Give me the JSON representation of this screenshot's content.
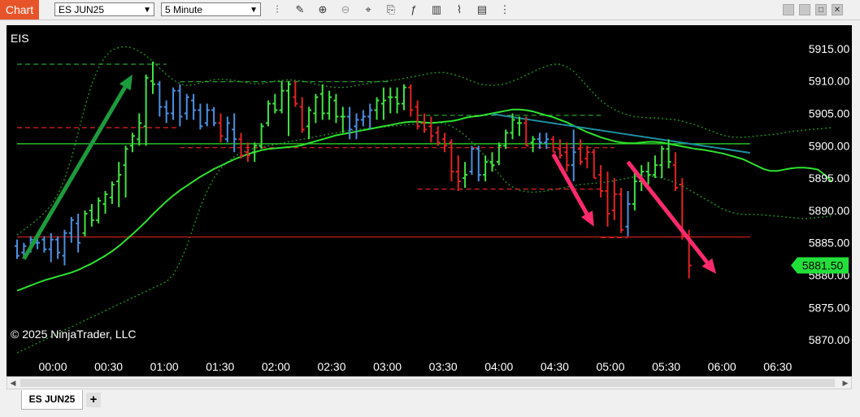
{
  "toolbar": {
    "chart_tab": "Chart",
    "instrument": "ES JUN25",
    "interval": "5 Minute",
    "tool_icons": [
      "bar-style-icon",
      "draw-pencil-icon",
      "zoom-in-icon",
      "zoom-out-icon",
      "crosshair-icon",
      "data-box-icon",
      "indicators-icon",
      "strategies-icon",
      "templates-icon",
      "properties-icon",
      "hide-drawings-icon"
    ]
  },
  "window_buttons": [
    "minimize",
    "restore",
    "maximize",
    "close"
  ],
  "bottom_tabs": {
    "instrument_tab": "ES JUN25",
    "add_tab": "+"
  },
  "chart_data": {
    "type": "ohlc",
    "instrument_label": "EIS",
    "copyright": "© 2025 NinjaTrader, LLC",
    "x_tick_labels": [
      "00:00",
      "00:30",
      "01:00",
      "01:30",
      "02:00",
      "02:30",
      "03:00",
      "03:30",
      "04:00",
      "04:30",
      "05:00",
      "05:30",
      "06:00",
      "06:30"
    ],
    "y_tick_labels": [
      "5915.00",
      "5910.00",
      "5905.00",
      "5900.00",
      "5895.00",
      "5890.00",
      "5885.00",
      "5880.00",
      "5875.00",
      "5870.00"
    ],
    "ylim": [
      5867.5,
      5918.5
    ],
    "last_price": "5881.50",
    "colors": {
      "background": "#000000",
      "up_bar": "#3fe43f",
      "down_bar": "#e52222",
      "neutral_bar": "#4a90e2",
      "bollinger": "#1f8f1f",
      "moving_average": "#2ee22e",
      "annotation_green": "#1c9c3c",
      "annotation_pink": "#ff2a6d",
      "trendline": "#1e8fa0",
      "support_line": "#c81e1e",
      "last_price_bg": "#22e03a"
    },
    "bars": [
      [
        5884.5,
        5885.5,
        5882.5,
        5883.0,
        "n"
      ],
      [
        5883.5,
        5885.0,
        5882.5,
        5884.5,
        "n"
      ],
      [
        5884.0,
        5886.0,
        5883.5,
        5885.5,
        "n"
      ],
      [
        5885.0,
        5886.5,
        5884.0,
        5885.0,
        "n"
      ],
      [
        5885.5,
        5886.0,
        5883.5,
        5884.0,
        "n"
      ],
      [
        5884.0,
        5886.5,
        5882.0,
        5885.5,
        "n"
      ],
      [
        5885.5,
        5886.0,
        5882.5,
        5883.5,
        "n"
      ],
      [
        5883.0,
        5887.0,
        5881.5,
        5886.5,
        "n"
      ],
      [
        5886.5,
        5889.0,
        5885.0,
        5888.5,
        "n"
      ],
      [
        5888.0,
        5889.5,
        5883.5,
        5885.0,
        "n"
      ],
      [
        5886.5,
        5890.0,
        5886.0,
        5889.5,
        "u"
      ],
      [
        5890.0,
        5891.0,
        5887.5,
        5888.5,
        "u"
      ],
      [
        5888.5,
        5892.0,
        5888.0,
        5891.5,
        "u"
      ],
      [
        5891.0,
        5893.0,
        5889.5,
        5892.5,
        "u"
      ],
      [
        5892.0,
        5894.5,
        5891.0,
        5894.0,
        "u"
      ],
      [
        5894.5,
        5897.5,
        5890.5,
        5895.5,
        "u"
      ],
      [
        5897.0,
        5900.0,
        5892.0,
        5899.5,
        "u"
      ],
      [
        5900.0,
        5902.0,
        5899.0,
        5901.5,
        "u"
      ],
      [
        5901.0,
        5905.0,
        5900.0,
        5903.5,
        "u"
      ],
      [
        5903.0,
        5911.0,
        5900.0,
        5910.5,
        "u"
      ],
      [
        5910.0,
        5913.0,
        5908.0,
        5909.5,
        "u"
      ],
      [
        5909.5,
        5910.0,
        5904.5,
        5906.0,
        "n"
      ],
      [
        5906.0,
        5907.0,
        5903.5,
        5905.0,
        "n"
      ],
      [
        5905.0,
        5909.0,
        5904.0,
        5908.5,
        "n"
      ],
      [
        5908.5,
        5909.5,
        5903.0,
        5904.5,
        "n"
      ],
      [
        5905.0,
        5908.0,
        5904.0,
        5907.5,
        "n"
      ],
      [
        5907.0,
        5908.0,
        5904.0,
        5905.5,
        "n"
      ],
      [
        5905.5,
        5906.5,
        5902.5,
        5903.0,
        "n"
      ],
      [
        5903.5,
        5906.5,
        5903.0,
        5905.5,
        "n"
      ],
      [
        5905.5,
        5906.0,
        5903.0,
        5903.5,
        "n"
      ],
      [
        5903.5,
        5905.0,
        5900.5,
        5901.5,
        "d"
      ],
      [
        5901.0,
        5904.5,
        5900.5,
        5903.5,
        "n"
      ],
      [
        5902.5,
        5905.0,
        5899.0,
        5901.0,
        "n"
      ],
      [
        5901.0,
        5902.0,
        5898.0,
        5898.5,
        "d"
      ],
      [
        5899.0,
        5900.5,
        5897.5,
        5898.5,
        "d"
      ],
      [
        5899.0,
        5900.5,
        5897.5,
        5900.0,
        "u"
      ],
      [
        5900.0,
        5903.5,
        5899.5,
        5903.0,
        "u"
      ],
      [
        5903.5,
        5907.0,
        5903.0,
        5906.5,
        "u"
      ],
      [
        5906.5,
        5908.0,
        5905.0,
        5905.5,
        "u"
      ],
      [
        5905.5,
        5910.0,
        5905.0,
        5908.5,
        "u"
      ],
      [
        5908.5,
        5910.0,
        5901.5,
        5909.5,
        "u"
      ],
      [
        5907.5,
        5910.0,
        5906.0,
        5906.5,
        "d"
      ],
      [
        5906.0,
        5907.5,
        5902.0,
        5902.5,
        "d"
      ],
      [
        5903.0,
        5906.0,
        5901.0,
        5905.5,
        "u"
      ],
      [
        5905.0,
        5908.0,
        5903.5,
        5907.5,
        "u"
      ],
      [
        5908.0,
        5909.5,
        5904.0,
        5905.0,
        "u"
      ],
      [
        5905.0,
        5908.5,
        5904.0,
        5907.5,
        "u"
      ],
      [
        5907.0,
        5908.0,
        5903.5,
        5904.5,
        "u"
      ],
      [
        5904.5,
        5906.0,
        5902.0,
        5904.5,
        "u"
      ],
      [
        5904.5,
        5906.0,
        5901.0,
        5902.5,
        "n"
      ],
      [
        5903.0,
        5905.0,
        5901.0,
        5904.0,
        "n"
      ],
      [
        5904.0,
        5905.5,
        5903.0,
        5904.5,
        "n"
      ],
      [
        5904.5,
        5906.5,
        5902.5,
        5905.5,
        "n"
      ],
      [
        5905.5,
        5907.5,
        5904.0,
        5907.0,
        "u"
      ],
      [
        5906.5,
        5909.0,
        5904.0,
        5907.0,
        "u"
      ],
      [
        5907.5,
        5909.0,
        5905.0,
        5907.5,
        "u"
      ],
      [
        5907.5,
        5909.0,
        5905.0,
        5906.5,
        "u"
      ],
      [
        5906.5,
        5909.5,
        5905.5,
        5909.0,
        "u"
      ],
      [
        5909.0,
        5909.5,
        5904.5,
        5905.5,
        "d"
      ],
      [
        5906.0,
        5907.0,
        5902.5,
        5903.0,
        "d"
      ],
      [
        5903.5,
        5905.0,
        5902.0,
        5902.5,
        "d"
      ],
      [
        5903.0,
        5904.5,
        5900.5,
        5901.5,
        "d"
      ],
      [
        5902.0,
        5903.0,
        5900.0,
        5900.5,
        "d"
      ],
      [
        5901.0,
        5902.0,
        5899.0,
        5900.0,
        "d"
      ],
      [
        5900.5,
        5901.0,
        5894.5,
        5896.0,
        "d"
      ],
      [
        5896.0,
        5898.5,
        5893.0,
        5894.5,
        "d"
      ],
      [
        5895.0,
        5897.5,
        5893.5,
        5895.5,
        "u"
      ],
      [
        5896.0,
        5900.0,
        5895.5,
        5899.5,
        "n"
      ],
      [
        5899.5,
        5900.0,
        5894.5,
        5895.5,
        "n"
      ],
      [
        5895.5,
        5898.5,
        5894.5,
        5897.5,
        "u"
      ],
      [
        5897.5,
        5899.0,
        5896.0,
        5897.0,
        "u"
      ],
      [
        5897.5,
        5900.5,
        5897.0,
        5900.0,
        "u"
      ],
      [
        5900.0,
        5902.5,
        5899.5,
        5902.0,
        "u"
      ],
      [
        5902.0,
        5905.0,
        5901.0,
        5904.0,
        "u"
      ],
      [
        5903.5,
        5904.5,
        5901.5,
        5903.5,
        "u"
      ],
      [
        5903.5,
        5904.5,
        5900.0,
        5900.0,
        "d"
      ],
      [
        5900.5,
        5901.5,
        5899.0,
        5901.0,
        "u"
      ],
      [
        5901.0,
        5902.0,
        5899.5,
        5900.5,
        "n"
      ],
      [
        5900.5,
        5902.0,
        5899.5,
        5901.0,
        "n"
      ],
      [
        5901.0,
        5901.5,
        5899.0,
        5899.0,
        "d"
      ],
      [
        5899.5,
        5901.0,
        5898.0,
        5898.5,
        "d"
      ],
      [
        5899.0,
        5900.5,
        5896.0,
        5897.0,
        "d"
      ],
      [
        5897.0,
        5902.5,
        5894.5,
        5899.0,
        "n"
      ],
      [
        5899.5,
        5901.0,
        5897.0,
        5897.5,
        "d"
      ],
      [
        5898.0,
        5900.0,
        5896.5,
        5899.0,
        "d"
      ],
      [
        5899.0,
        5899.5,
        5895.0,
        5895.0,
        "d"
      ],
      [
        5895.5,
        5897.0,
        5892.0,
        5893.0,
        "d"
      ],
      [
        5893.0,
        5896.0,
        5887.5,
        5889.5,
        "d"
      ],
      [
        5890.0,
        5895.0,
        5888.5,
        5892.5,
        "d"
      ],
      [
        5892.5,
        5893.5,
        5886.5,
        5887.0,
        "d"
      ],
      [
        5887.5,
        5893.0,
        5886.0,
        5891.0,
        "n"
      ],
      [
        5891.0,
        5896.0,
        5890.0,
        5894.5,
        "u"
      ],
      [
        5894.5,
        5897.0,
        5893.0,
        5896.0,
        "u"
      ],
      [
        5896.0,
        5897.5,
        5894.0,
        5895.5,
        "u"
      ],
      [
        5895.5,
        5898.5,
        5895.0,
        5897.0,
        "u"
      ],
      [
        5897.0,
        5900.0,
        5895.0,
        5899.5,
        "u"
      ],
      [
        5899.5,
        5901.0,
        5896.5,
        5897.5,
        "u"
      ],
      [
        5897.0,
        5899.0,
        5893.0,
        5893.5,
        "d"
      ],
      [
        5894.0,
        5895.0,
        5885.5,
        5886.0,
        "d"
      ],
      [
        5886.0,
        5887.0,
        5879.5,
        5881.5,
        "d"
      ]
    ],
    "moving_average": [
      5877.6,
      5878.0,
      5878.4,
      5878.8,
      5879.2,
      5879.5,
      5879.8,
      5880.1,
      5880.4,
      5880.8,
      5881.3,
      5881.8,
      5882.4,
      5883.0,
      5883.7,
      5884.5,
      5885.4,
      5886.3,
      5887.3,
      5888.3,
      5889.4,
      5890.4,
      5891.4,
      5892.3,
      5893.1,
      5893.8,
      5894.5,
      5895.2,
      5895.8,
      5896.4,
      5896.9,
      5897.4,
      5897.9,
      5898.3,
      5898.7,
      5899.0,
      5899.3,
      5899.5,
      5899.6,
      5899.7,
      5899.8,
      5899.9,
      5900.1,
      5900.4,
      5900.7,
      5901.0,
      5901.3,
      5901.6,
      5901.8,
      5902.0,
      5902.2,
      5902.4,
      5902.6,
      5902.8,
      5903.0,
      5903.2,
      5903.4,
      5903.6,
      5903.7,
      5903.7,
      5903.6,
      5903.5,
      5903.6,
      5903.7,
      5903.8,
      5904.0,
      5904.3,
      5904.5,
      5904.6,
      5904.8,
      5905.0,
      5905.2,
      5905.4,
      5905.6,
      5905.6,
      5905.5,
      5905.3,
      5905.0,
      5904.7,
      5904.4,
      5904.0,
      5903.6,
      5903.1,
      5902.6,
      5902.1,
      5901.7,
      5901.3,
      5901.0,
      5900.7,
      5900.5,
      5900.4,
      5900.4,
      5900.5,
      5900.6,
      5900.6,
      5900.5,
      5900.3,
      5900.1,
      5899.9,
      5899.7,
      5899.5,
      5899.4,
      5899.2,
      5899.0,
      5898.8,
      5898.5,
      5898.2,
      5897.9,
      5897.4,
      5896.9,
      5896.4,
      5896.1,
      5896.1,
      5896.3,
      5896.5,
      5896.6,
      5896.6,
      5896.5,
      5896.3,
      5895.5,
      5894.5
    ],
    "bollinger_upper": [
      5886.2,
      5887.0,
      5887.8,
      5888.6,
      5889.6,
      5890.8,
      5892.5,
      5894.8,
      5898.0,
      5902.0,
      5906.0,
      5909.5,
      5912.0,
      5913.8,
      5914.8,
      5915.2,
      5915.3,
      5915.1,
      5914.6,
      5913.9,
      5913.0,
      5912.0,
      5911.0,
      5910.2,
      5909.6,
      5909.3,
      5909.4,
      5909.7,
      5910.0,
      5910.2,
      5910.3,
      5910.2,
      5910.1,
      5909.9,
      5909.7,
      5909.6,
      5909.6,
      5909.8,
      5910.0,
      5910.1,
      5910.2,
      5910.1,
      5910.0,
      5909.8,
      5909.5,
      5909.3,
      5909.1,
      5909.0,
      5909.0,
      5909.1,
      5909.3,
      5909.5,
      5909.7,
      5909.9,
      5910.0,
      5910.1,
      5910.2,
      5910.4,
      5910.6,
      5910.8,
      5911.0,
      5911.2,
      5911.3,
      5911.3,
      5911.1,
      5910.8,
      5910.4,
      5910.0,
      5909.6,
      5909.4,
      5909.3,
      5909.4,
      5909.6,
      5910.0,
      5910.4,
      5910.9,
      5911.4,
      5911.9,
      5912.3,
      5912.6,
      5912.6,
      5912.2,
      5911.5,
      5910.4,
      5909.2,
      5908.0,
      5907.0,
      5906.2,
      5905.6,
      5905.1,
      5904.8,
      5904.5,
      5904.4,
      5904.3,
      5904.3,
      5904.2,
      5904.1,
      5904.0,
      5903.8,
      5903.5,
      5903.2,
      5902.8,
      5902.4,
      5902.0,
      5901.6,
      5901.4,
      5901.3,
      5901.3,
      5901.4,
      5901.5,
      5901.6,
      5901.7,
      5901.8,
      5902.0,
      5902.2,
      5902.3,
      5902.4,
      5902.5,
      5902.6,
      5902.7,
      5902.8
    ],
    "bollinger_lower": [
      5868.0,
      5868.5,
      5869.0,
      5869.5,
      5870.0,
      5870.5,
      5871.0,
      5871.5,
      5872.0,
      5872.5,
      5873.0,
      5873.5,
      5874.0,
      5874.5,
      5875.0,
      5875.5,
      5876.0,
      5876.5,
      5877.0,
      5877.5,
      5878.0,
      5878.5,
      5879.0,
      5880.0,
      5882.0,
      5884.5,
      5887.5,
      5890.5,
      5893.0,
      5895.0,
      5896.5,
      5897.5,
      5898.3,
      5898.9,
      5899.3,
      5899.6,
      5899.8,
      5900.0,
      5900.2,
      5900.4,
      5900.6,
      5900.8,
      5901.0,
      5901.2,
      5901.4,
      5901.6,
      5901.8,
      5902.0,
      5902.2,
      5902.4,
      5902.5,
      5902.6,
      5902.7,
      5902.8,
      5902.9,
      5903.0,
      5903.1,
      5903.2,
      5903.3,
      5903.4,
      5903.5,
      5903.6,
      5903.6,
      5903.4,
      5903.0,
      5902.4,
      5901.6,
      5900.6,
      5899.5,
      5898.3,
      5897.0,
      5895.6,
      5894.4,
      5893.6,
      5893.1,
      5892.9,
      5892.8,
      5892.9,
      5893.0,
      5893.2,
      5893.4,
      5893.6,
      5893.8,
      5894.0,
      5894.1,
      5894.2,
      5894.3,
      5894.4,
      5894.6,
      5894.8,
      5895.0,
      5895.2,
      5895.3,
      5895.3,
      5895.2,
      5895.0,
      5894.7,
      5894.3,
      5893.8,
      5893.2,
      5892.6,
      5892.0,
      5891.4,
      5890.8,
      5890.2,
      5889.8,
      5889.5,
      5889.4,
      5889.4,
      5889.4,
      5889.3,
      5889.2,
      5889.1,
      5889.0,
      5888.9,
      5888.8,
      5888.7,
      5888.8,
      5888.9,
      5889.0,
      5889.2
    ],
    "horizontal_lines": [
      {
        "price": 5900.3,
        "style": "solid",
        "color": "#2ee22e",
        "from_bar": 0,
        "to_bar": 108
      },
      {
        "price": 5885.9,
        "style": "solid",
        "color": "#c81e1e",
        "from_bar": 0,
        "to_bar": 108
      },
      {
        "price": 5912.6,
        "style": "dashed",
        "color": "#2ca02c",
        "from_bar": 0,
        "to_bar": 22
      },
      {
        "price": 5902.8,
        "style": "dashed",
        "color": "#e52222",
        "from_bar": 0,
        "to_bar": 24
      },
      {
        "price": 5909.9,
        "style": "dashed",
        "color": "#2ca02c",
        "from_bar": 24,
        "to_bar": 55
      },
      {
        "price": 5899.7,
        "style": "dashed",
        "color": "#e52222",
        "from_bar": 24,
        "to_bar": 88
      },
      {
        "price": 5904.7,
        "style": "dashed",
        "color": "#2ca02c",
        "from_bar": 59,
        "to_bar": 86
      },
      {
        "price": 5893.3,
        "style": "dashed",
        "color": "#e52222",
        "from_bar": 59,
        "to_bar": 86
      },
      {
        "price": 5885.8,
        "style": "dashed",
        "color": "#e52222",
        "from_bar": 86,
        "to_bar": 90
      }
    ],
    "trendline": {
      "from": [
        70,
        5904.9
      ],
      "to": [
        108,
        5898.9
      ]
    },
    "arrows": [
      {
        "from": [
          1,
          5882.5
        ],
        "to": [
          17,
          5911.0
        ],
        "color": "#1c9c3c"
      },
      {
        "from": [
          79,
          5898.7
        ],
        "to": [
          85,
          5887.5
        ],
        "color": "#ff2a6d"
      },
      {
        "from": [
          90,
          5897.5
        ],
        "to": [
          103,
          5880.2
        ],
        "color": "#ff2a6d"
      }
    ]
  }
}
